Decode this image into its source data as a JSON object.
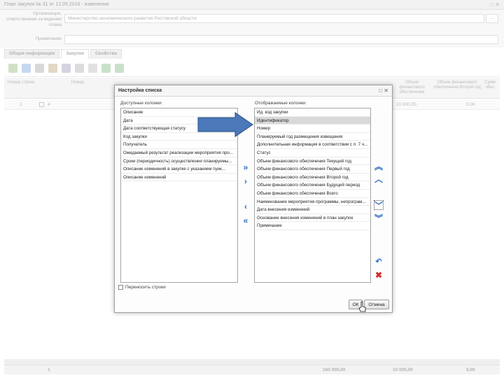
{
  "window": {
    "title": "План закупок № 31 от 12.05.2016 - изменение",
    "controls": "□ ✕"
  },
  "form": {
    "org_label": "Организация, ответственная за ведение плана",
    "org_value": "Министерство экономического развития Ростовской области",
    "note_label": "Примечание",
    "note_value": "",
    "lookup_btn": "..."
  },
  "tabs": [
    "Общая информация",
    "Закупки",
    "Свойства"
  ],
  "grid": {
    "headers": [
      "Номер строки",
      "Номер",
      "Объем финансового обеспечения",
      "Объем финансового обеспечения Второй год",
      "Сумм обес"
    ],
    "row": {
      "pos": "1",
      "num": "4",
      "amount1": "10 000,00",
      "amount2": "0,00"
    },
    "footer": {
      "count": "1",
      "total1": "160 000,00",
      "total2": "10 000,00",
      "total3": "0,00"
    }
  },
  "dialog": {
    "title": "Настройка списка",
    "controls": "□ ✕",
    "available_label": "Доступные колонки",
    "displayed_label": "Отображаемые колонки",
    "available": [
      "Описание",
      "Дата",
      "Дата соответствующая статусу",
      "Код закупки",
      "Получатель",
      "Ожидаемый результат реализации мероприятия про...",
      "Сроки (периодичность) осуществления планируемы...",
      "Описание изменений в закупке с указанием пунк...",
      "Описание изменений"
    ],
    "displayed": [
      "Ид. код закупки",
      "Идентификатор",
      "Номер",
      "Планируемый год размещения извещения",
      "Дополнительная информация в соответствии с п. 7 ч...",
      "Статус",
      "Объем финансового обеспечения Текущий год",
      "Объем финансового обеспечения Первый год",
      "Объем финансового обеспечения Второй год",
      "Объем финансового обеспечения Будущий период",
      "Объем финансового обеспечения Всего",
      "Наименование мероприятия программы, непрограм...",
      "Дата внесения изменений",
      "Основание внесения изменений в план закупок",
      "Примечание"
    ],
    "selected_index": 1,
    "checkbox_label": "Переносить строки",
    "ok_label": "ОК",
    "cancel_label": "Отмена"
  },
  "colors": {
    "accent": "#2f6fc4",
    "big_arrow": "#4a78b8",
    "delete": "#d0302b"
  }
}
